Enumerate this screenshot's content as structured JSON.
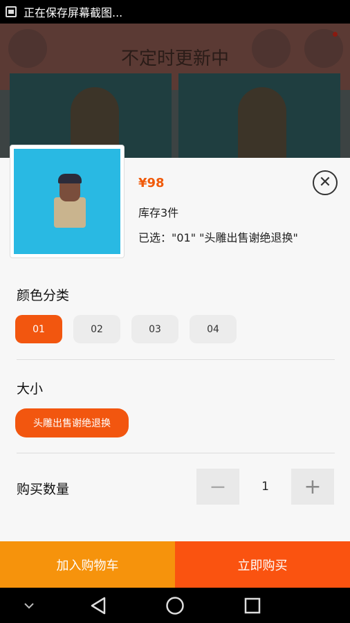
{
  "status_bar": {
    "text": "正在保存屏幕截图..."
  },
  "background": {
    "title": "不定时更新中"
  },
  "product": {
    "price": "¥98",
    "stock": "库存3件",
    "selected": "已选：\"01\" \"头雕出售谢绝退换\""
  },
  "color_section": {
    "label": "颜色分类",
    "options": [
      "01",
      "02",
      "03",
      "04"
    ],
    "selected": "01"
  },
  "size_section": {
    "label": "大小",
    "options": [
      "头雕出售谢绝退换"
    ]
  },
  "quantity": {
    "label": "购买数量",
    "value": "1"
  },
  "actions": {
    "add_to_cart": "加入购物车",
    "buy_now": "立即购买"
  },
  "colors": {
    "accent": "#f2560f",
    "cart": "#f6930c",
    "buy": "#fa5310"
  },
  "icons": [
    "screenshot-icon",
    "close-icon",
    "minus-icon",
    "plus-icon",
    "nav-down-icon",
    "nav-back-icon",
    "nav-home-icon",
    "nav-recents-icon"
  ]
}
